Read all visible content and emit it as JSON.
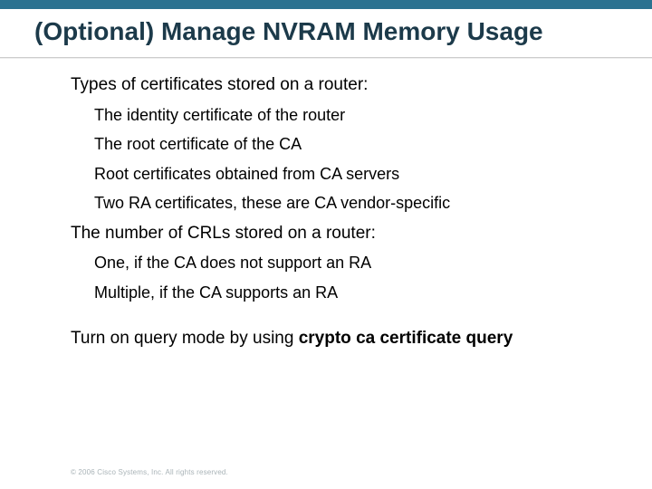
{
  "title": "(Optional) Manage NVRAM Memory Usage",
  "body": {
    "p1": "Types of certificates stored on a router:",
    "p1_items": {
      "a": "The identity certificate of the router",
      "b": "The root certificate of the CA",
      "c": "Root certificates obtained from CA servers",
      "d": "Two RA certificates, these are CA vendor-specific"
    },
    "p2": "The number of CRLs stored on a router:",
    "p2_items": {
      "a": "One, if the CA does not support an RA",
      "b": "Multiple, if the CA supports an RA"
    },
    "p3_pre": "Turn on query mode by using ",
    "p3_bold": "crypto ca certificate query"
  },
  "footer": "© 2006 Cisco Systems, Inc. All rights reserved."
}
